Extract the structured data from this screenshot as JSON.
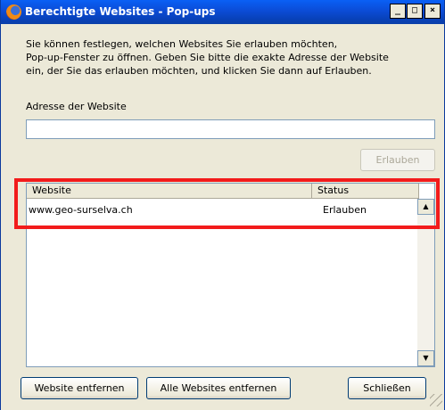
{
  "window": {
    "title": "Berechtigte Websites - Pop-ups",
    "controls": {
      "minimize": "_",
      "maximize": "□",
      "close": "×"
    }
  },
  "description": "Sie können festlegen, welchen Websites Sie erlauben möchten,\nPop-up-Fenster zu öffnen. Geben Sie bitte die exakte Adresse der Website\nein, der Sie das erlauben möchten, und klicken Sie dann auf Erlauben.",
  "address": {
    "label": "Adresse der Website",
    "value": ""
  },
  "buttons": {
    "allow": "Erlauben",
    "remove": "Website entfernen",
    "remove_all": "Alle Websites entfernen",
    "close": "Schließen"
  },
  "table": {
    "columns": [
      "Website",
      "Status"
    ],
    "rows": [
      {
        "website": "www.geo-surselva.ch",
        "status": "Erlauben"
      }
    ]
  },
  "colors": {
    "titlebar": "#0b4cd6",
    "highlight": "#f21b1b",
    "dialog_bg": "#ece9d8"
  }
}
